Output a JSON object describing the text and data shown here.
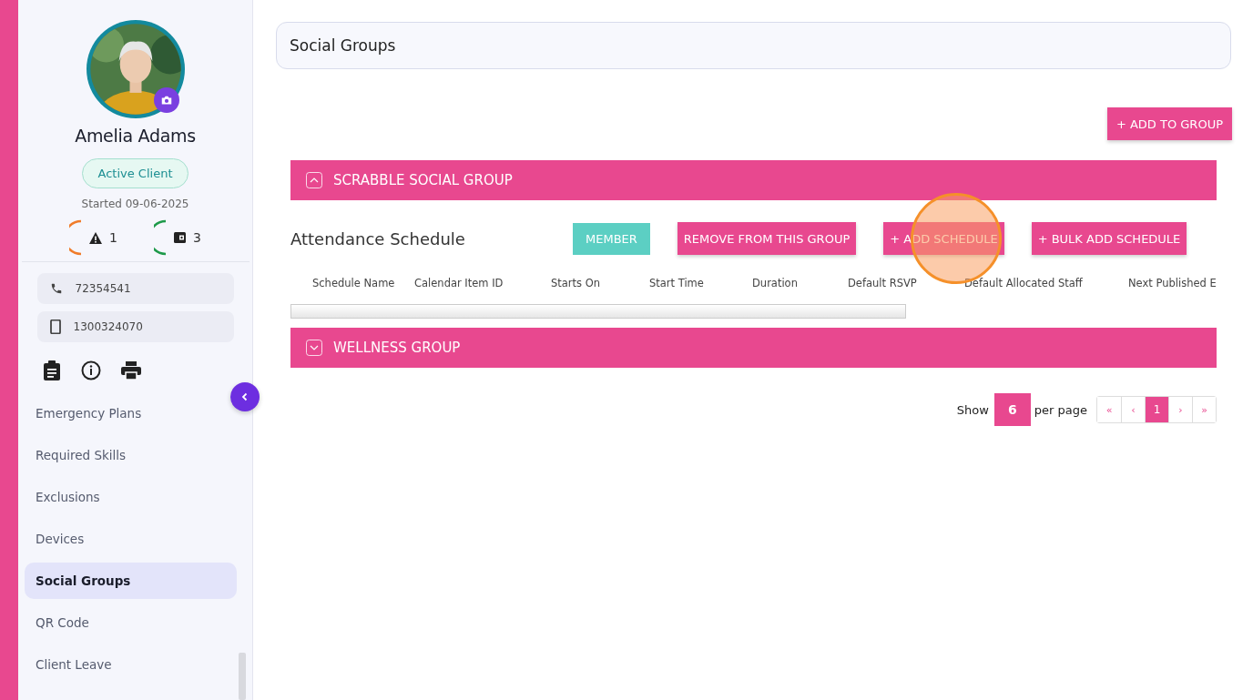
{
  "profile": {
    "name": "Amelia Adams",
    "status": "Active Client",
    "started": "Started 09-06-2025",
    "counters": [
      {
        "kind": "alert",
        "count": "1",
        "color": "#f07c2a"
      },
      {
        "kind": "wallet",
        "count": "3",
        "color": "#1e9a4a"
      }
    ],
    "contacts": [
      {
        "kind": "phone",
        "value": "72354541"
      },
      {
        "kind": "mobile",
        "value": "1300324070"
      }
    ]
  },
  "sidebar": {
    "items": [
      {
        "label": "Emergency Plans",
        "selected": false
      },
      {
        "label": "Required Skills",
        "selected": false
      },
      {
        "label": "Exclusions",
        "selected": false
      },
      {
        "label": "Devices",
        "selected": false
      },
      {
        "label": "Social Groups",
        "selected": true
      },
      {
        "label": "QR Code",
        "selected": false
      },
      {
        "label": "Client Leave",
        "selected": false
      }
    ]
  },
  "page": {
    "title": "Social Groups",
    "add_button": "+ ADD TO GROUP"
  },
  "groups": [
    {
      "name": "SCRABBLE SOCIAL GROUP",
      "expanded": true,
      "section_title": "Attendance Schedule",
      "buttons": [
        {
          "kind": "member",
          "label": "MEMBER"
        },
        {
          "kind": "action",
          "label": "REMOVE FROM THIS GROUP"
        },
        {
          "kind": "action",
          "label": "+ ADD SCHEDULE"
        },
        {
          "kind": "action",
          "label": "+ BULK ADD SCHEDULE"
        }
      ],
      "columns": [
        "Schedule Name",
        "Calendar Item ID",
        "Starts On",
        "Start Time",
        "Duration",
        "Default RSVP",
        "Default Allocated Staff",
        "Next Published E"
      ]
    },
    {
      "name": "WELLNESS GROUP",
      "expanded": false
    }
  ],
  "pagination": {
    "show_label": "Show",
    "per_page": "6",
    "per_page_label": "per page",
    "pages": [
      {
        "label": "«",
        "selected": false
      },
      {
        "label": "‹",
        "selected": false
      },
      {
        "label": "1",
        "selected": true
      },
      {
        "label": "›",
        "selected": false
      },
      {
        "label": "»",
        "selected": false
      }
    ]
  }
}
